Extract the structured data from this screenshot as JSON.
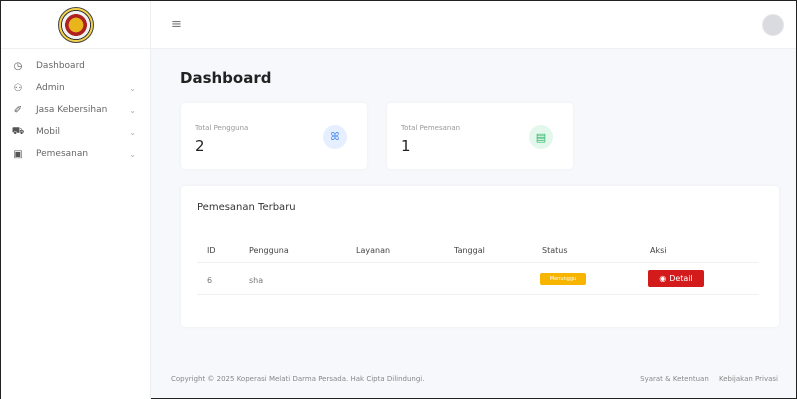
{
  "sidebar": {
    "items": [
      {
        "icon": "dashboard-icon",
        "glyph": "◷",
        "label": "Dashboard",
        "has_chevron": false
      },
      {
        "icon": "users-icon",
        "glyph": "⚇",
        "label": "Admin",
        "has_chevron": true
      },
      {
        "icon": "brush-icon",
        "glyph": "✐",
        "label": "Jasa Kebersihan",
        "has_chevron": true
      },
      {
        "icon": "car-icon",
        "glyph": "⛟",
        "label": "Mobil",
        "has_chevron": true
      },
      {
        "icon": "calendar-icon",
        "glyph": "▣",
        "label": "Pemesanan",
        "has_chevron": true
      }
    ]
  },
  "topbar": {
    "menu_glyph": "≡"
  },
  "main": {
    "title": "Dashboard",
    "stats": [
      {
        "label": "Total Pengguna",
        "value": "2",
        "icon": "user-icon",
        "glyph": "ꕤ",
        "color": "#4a8cf0",
        "bg": "#e6efff"
      },
      {
        "label": "Total Pemesanan",
        "value": "1",
        "icon": "calendar-icon",
        "glyph": "▤",
        "color": "#28b463",
        "bg": "#e4f7ec"
      }
    ],
    "recent": {
      "title": "Pemesanan Terbaru",
      "headers": [
        "ID",
        "Pengguna",
        "Layanan",
        "Tanggal",
        "Status",
        "Aksi"
      ],
      "rows": [
        {
          "id": "6",
          "pengguna": "sha",
          "layanan": "",
          "tanggal": "",
          "status": "Menunggu",
          "aksi": "Detail"
        }
      ]
    }
  },
  "footer": {
    "copyright": "Copyright © 2025 Koperasi Melati Darma Persada. Hak Cipta Dilindungi.",
    "links": [
      "Syarat & Ketentuan",
      "Kebijakan Privasi"
    ]
  },
  "colors": {
    "status_badge": "#f7b500",
    "detail_button": "#d41b1b"
  }
}
